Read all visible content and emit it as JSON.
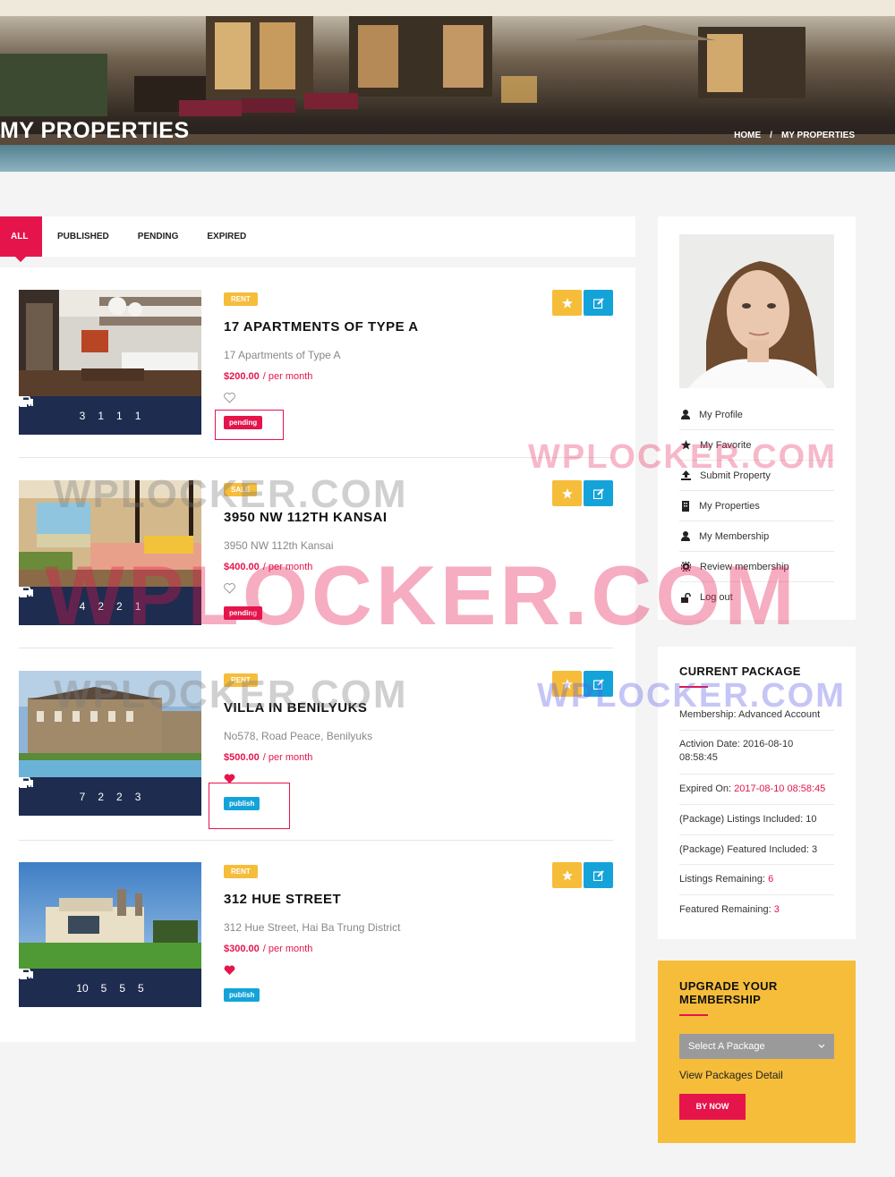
{
  "page_title": "MY PROPERTIES",
  "breadcrumb": {
    "home": "HOME",
    "separator": "/",
    "current": "MY PROPERTIES"
  },
  "tabs": [
    "ALL",
    "PUBLISHED",
    "PENDING",
    "EXPIRED"
  ],
  "currency_suffix": "/ per month",
  "properties": [
    {
      "badge": "RENT",
      "title": "17 APARTMENTS OF TYPE A",
      "address": "17 Apartments of Type A",
      "price": "$200.00",
      "favorited": false,
      "status": "pending",
      "stats": {
        "rooms": "3",
        "baths": "1",
        "beds": "1",
        "garages": "1"
      }
    },
    {
      "badge": "SALE",
      "title": "3950 NW 112TH KANSAI",
      "address": "3950 NW 112th Kansai",
      "price": "$400.00",
      "favorited": false,
      "status": "pending",
      "stats": {
        "rooms": "4",
        "baths": "2",
        "beds": "2",
        "garages": "1"
      }
    },
    {
      "badge": "RENT",
      "title": "VILLA IN BENILYUKS",
      "address": "No578, Road Peace, Benilyuks",
      "price": "$500.00",
      "favorited": true,
      "status": "publish",
      "stats": {
        "rooms": "7",
        "baths": "2",
        "beds": "2",
        "garages": "3"
      }
    },
    {
      "badge": "RENT",
      "title": "312 HUE STREET",
      "address": "312 Hue Street, Hai Ba Trung District",
      "price": "$300.00",
      "favorited": true,
      "status": "publish",
      "stats": {
        "rooms": "10",
        "baths": "5",
        "beds": "5",
        "garages": "5"
      }
    }
  ],
  "sidebar_menu": [
    {
      "label": "My Profile",
      "icon": "user-icon"
    },
    {
      "label": "My Favorite",
      "icon": "star-icon"
    },
    {
      "label": "Submit Property",
      "icon": "upload-icon"
    },
    {
      "label": "My Properties",
      "icon": "building-icon"
    },
    {
      "label": "My Membership",
      "icon": "user-icon"
    },
    {
      "label": "Review membership",
      "icon": "cog-icon"
    },
    {
      "label": "Log out",
      "icon": "unlock-icon"
    }
  ],
  "current_package": {
    "title": "CURRENT PACKAGE",
    "membership_label": "Membership:",
    "membership_value": "Advanced Account",
    "activation_label": "Activion Date:",
    "activation_value": "2016-08-10 08:58:45",
    "expired_label": "Expired On:",
    "expired_value": "2017-08-10 08:58:45",
    "listings_included_label": "(Package) Listings Included:",
    "listings_included_value": "10",
    "featured_included_label": "(Package) Featured Included:",
    "featured_included_value": "3",
    "listings_remaining_label": "Listings Remaining:",
    "listings_remaining_value": "6",
    "featured_remaining_label": "Featured Remaining:",
    "featured_remaining_value": "3"
  },
  "upgrade": {
    "title": "UPGRADE YOUR MEMBERSHIP",
    "select_value": "Select A Package",
    "view_link": "View Packages Detail",
    "buy_label": "BY NOW"
  },
  "watermarks": {
    "small": "WPLOCKER.COM",
    "large": "WPLOCKER.COM"
  },
  "colors": {
    "accent": "#e5154c",
    "yellow": "#f6bd3b",
    "blue": "#14a3d9",
    "navy": "#1e2c4f"
  }
}
